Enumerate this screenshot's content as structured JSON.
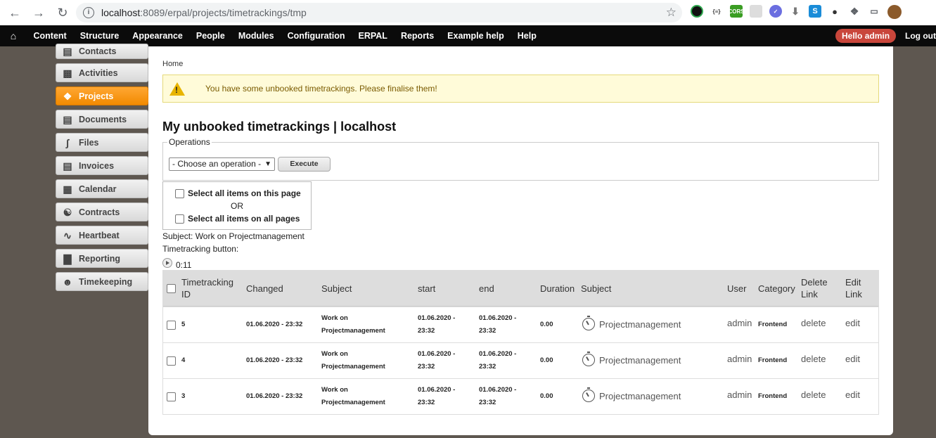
{
  "browser": {
    "url_host": "localhost",
    "url_path": ":8089/erpal/projects/timetrackings/tmp",
    "ext_cors": "CORS",
    "ext_json": "{≡}",
    "ext_s": "S"
  },
  "toolbar": {
    "items": [
      "Content",
      "Structure",
      "Appearance",
      "People",
      "Modules",
      "Configuration",
      "ERPAL",
      "Reports",
      "Example help",
      "Help"
    ],
    "hello_prefix": "Hello",
    "hello_user": "admin",
    "logout": "Log out"
  },
  "sidebar": {
    "items": [
      {
        "label": "Contacts",
        "icon": "contacts-icon"
      },
      {
        "label": "Activities",
        "icon": "chat-icon"
      },
      {
        "label": "Projects",
        "icon": "projects-icon",
        "active": true
      },
      {
        "label": "Documents",
        "icon": "document-icon"
      },
      {
        "label": "Files",
        "icon": "paperclip-icon"
      },
      {
        "label": "Invoices",
        "icon": "invoice-icon"
      },
      {
        "label": "Calendar",
        "icon": "calendar-icon"
      },
      {
        "label": "Contracts",
        "icon": "handshake-icon"
      },
      {
        "label": "Heartbeat",
        "icon": "heartbeat-icon"
      },
      {
        "label": "Reporting",
        "icon": "bar-chart-icon"
      },
      {
        "label": "Timekeeping",
        "icon": "person-icon"
      }
    ]
  },
  "breadcrumb": "Home",
  "warning": "You have some unbooked timetrackings. Please finalise them!",
  "page_title": "My unbooked timetrackings | localhost",
  "operations": {
    "legend": "Operations",
    "select_value": "- Choose an operation -",
    "execute_label": "Execute"
  },
  "select_all": {
    "this_page": "Select all items on this page",
    "or": "OR",
    "all_pages": "Select all items on all pages"
  },
  "subject_line": "Subject: Work on Projectmanagement",
  "timetracking_button_label": "Timetracking button:",
  "timer_value": "0:11",
  "table": {
    "headers": {
      "id_1": "Timetracking",
      "id_2": "ID",
      "changed": "Changed",
      "subject": "Subject",
      "start": "start",
      "end": "end",
      "duration": "Duration",
      "subject2": "Subject",
      "user": "User",
      "category": "Category",
      "delete_1": "Delete",
      "delete_2": "Link",
      "edit_1": "Edit",
      "edit_2": "Link"
    },
    "rows": [
      {
        "id": "5",
        "changed": "01.06.2020 - 23:32",
        "subject_1": "Work on",
        "subject_2": "Projectmanagement",
        "start_1": "01.06.2020 -",
        "start_2": "23:32",
        "end_1": "01.06.2020 -",
        "end_2": "23:32",
        "duration": "0.00",
        "subject_link": "Projectmanagement",
        "user": "admin",
        "category": "Frontend",
        "delete": "delete",
        "edit": "edit"
      },
      {
        "id": "4",
        "changed": "01.06.2020 - 23:32",
        "subject_1": "Work on",
        "subject_2": "Projectmanagement",
        "start_1": "01.06.2020 -",
        "start_2": "23:32",
        "end_1": "01.06.2020 -",
        "end_2": "23:32",
        "duration": "0.00",
        "subject_link": "Projectmanagement",
        "user": "admin",
        "category": "Frontend",
        "delete": "delete",
        "edit": "edit"
      },
      {
        "id": "3",
        "changed": "01.06.2020 - 23:32",
        "subject_1": "Work on",
        "subject_2": "Projectmanagement",
        "start_1": "01.06.2020 -",
        "start_2": "23:32",
        "end_1": "01.06.2020 -",
        "end_2": "23:32",
        "duration": "0.00",
        "subject_link": "Projectmanagement",
        "user": "admin",
        "category": "Frontend",
        "delete": "delete",
        "edit": "edit"
      }
    ]
  }
}
